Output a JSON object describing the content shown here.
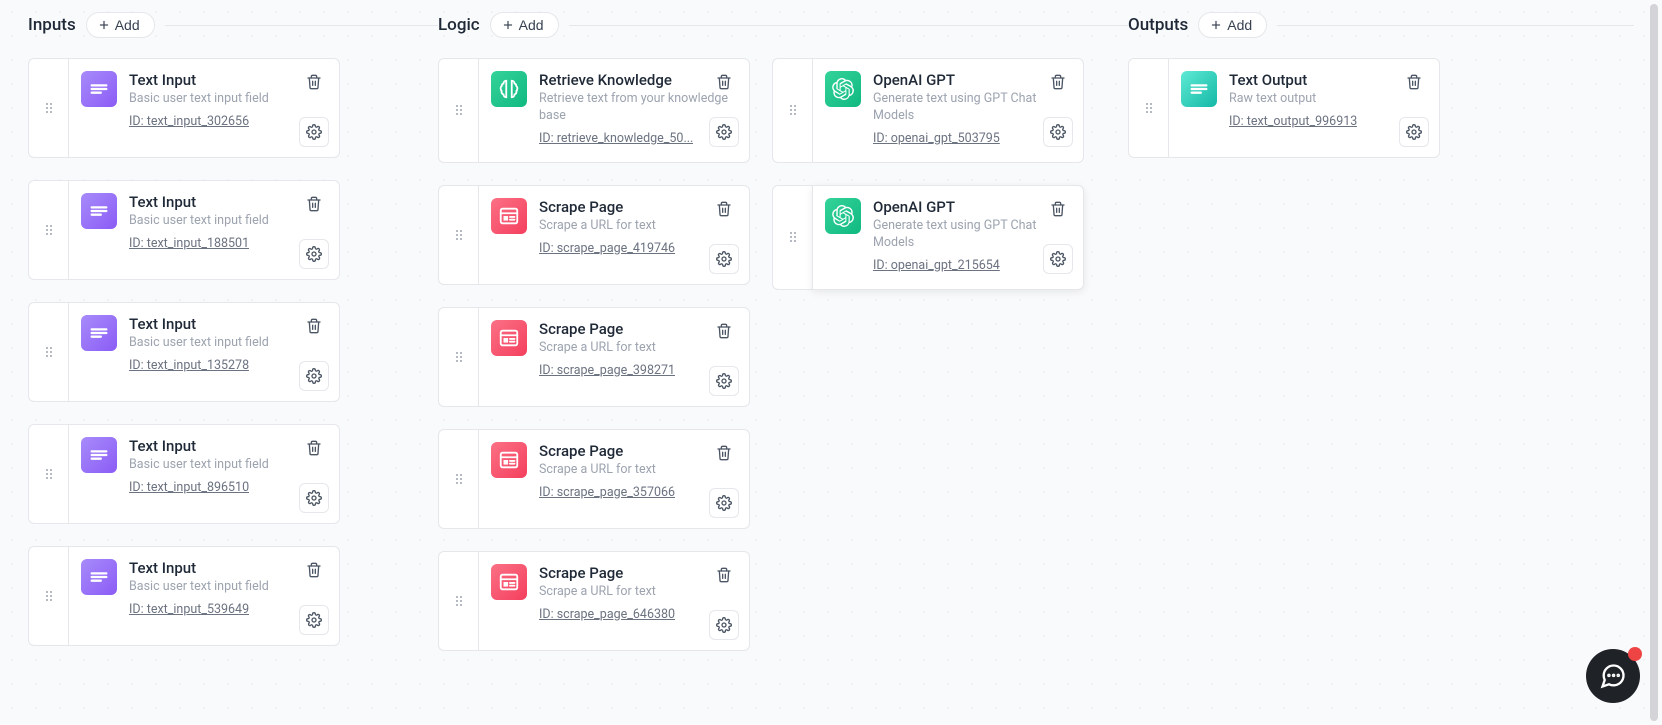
{
  "add_label": "Add",
  "sections": {
    "inputs": {
      "title": "Inputs"
    },
    "logic": {
      "title": "Logic"
    },
    "outputs": {
      "title": "Outputs"
    }
  },
  "id_prefix": "ID: ",
  "cards": {
    "text_input": {
      "title": "Text Input",
      "desc": "Basic user text input field"
    },
    "retrieve_knowledge": {
      "title": "Retrieve Knowledge",
      "desc": "Retrieve text from your knowledge base"
    },
    "openai_gpt": {
      "title": "OpenAI GPT",
      "desc": "Generate text using GPT Chat Models"
    },
    "scrape_page": {
      "title": "Scrape Page",
      "desc": "Scrape a URL for text"
    },
    "text_output": {
      "title": "Text Output",
      "desc": "Raw text output"
    }
  },
  "inputs": [
    {
      "id": "text_input_302656"
    },
    {
      "id": "text_input_188501"
    },
    {
      "id": "text_input_135278"
    },
    {
      "id": "text_input_896510"
    },
    {
      "id": "text_input_539649"
    }
  ],
  "logic_col1": [
    {
      "type": "retrieve_knowledge",
      "id": "retrieve_knowledge_50...",
      "icon": "green-brain"
    },
    {
      "type": "scrape_page",
      "id": "scrape_page_419746",
      "icon": "pink-page"
    },
    {
      "type": "scrape_page",
      "id": "scrape_page_398271",
      "icon": "pink-page"
    },
    {
      "type": "scrape_page",
      "id": "scrape_page_357066",
      "icon": "pink-page"
    },
    {
      "type": "scrape_page",
      "id": "scrape_page_646380",
      "icon": "pink-page"
    }
  ],
  "logic_col2": [
    {
      "type": "openai_gpt",
      "id": "openai_gpt_503795",
      "icon": "green-openai"
    },
    {
      "type": "openai_gpt",
      "id": "openai_gpt_215654",
      "icon": "green-openai",
      "highlighted": true
    }
  ],
  "outputs": [
    {
      "id": "text_output_996913"
    }
  ]
}
